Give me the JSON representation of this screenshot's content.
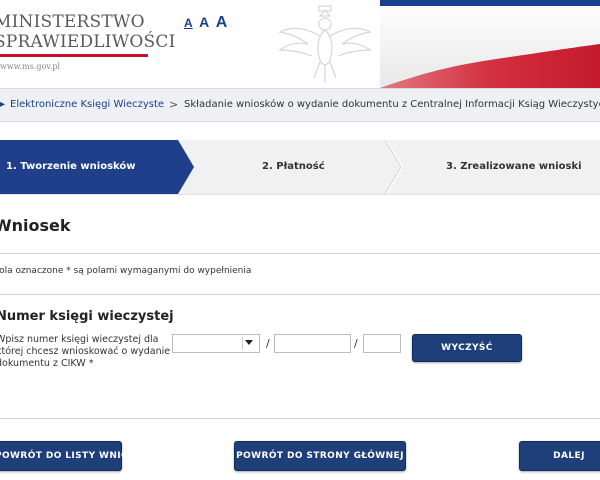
{
  "header": {
    "logo_line1": "MINISTERSTWO",
    "logo_line2": "SPRAWIEDLIWOŚCI",
    "logo_url": "www.ms.gov.pl",
    "font_controls": [
      "A",
      "A",
      "A"
    ],
    "colors": {
      "brand_red": "#c8102e",
      "brand_blue": "#1b3f8f"
    }
  },
  "breadcrumb": {
    "items": [
      "Elektroniczne Księgi Wieczyste",
      "Składanie wniosków o wydanie dokumentu z Centralnej Informacji Ksiąg Wieczystych"
    ],
    "separator": ">"
  },
  "steps": [
    {
      "label": "1. Tworzenie wniosków",
      "active": true
    },
    {
      "label": "2. Płatność",
      "active": false
    },
    {
      "label": "3. Zrealizowane wnioski",
      "active": false
    }
  ],
  "form": {
    "title": "Wniosek",
    "required_note": "Pola oznaczone * są polami wymaganymi do wypełnienia",
    "section_title": "Numer księgi wieczystej",
    "field_label_lines": [
      "Wpisz numer księgi wieczystej dla",
      "której chcesz wnioskować o wydanie",
      "dokumentu z CIKW *"
    ],
    "court_code_value": "",
    "number_value": "",
    "check_digit_value": "",
    "separator": "/",
    "clear_label": "WYCZYŚĆ"
  },
  "actions": {
    "back_to_list_label": "POWRÓT DO LISTY WNIOSKÓW",
    "back_home_label": "POWRÓT DO STRONY GŁÓWNEJ",
    "next_label": "DALEJ"
  }
}
